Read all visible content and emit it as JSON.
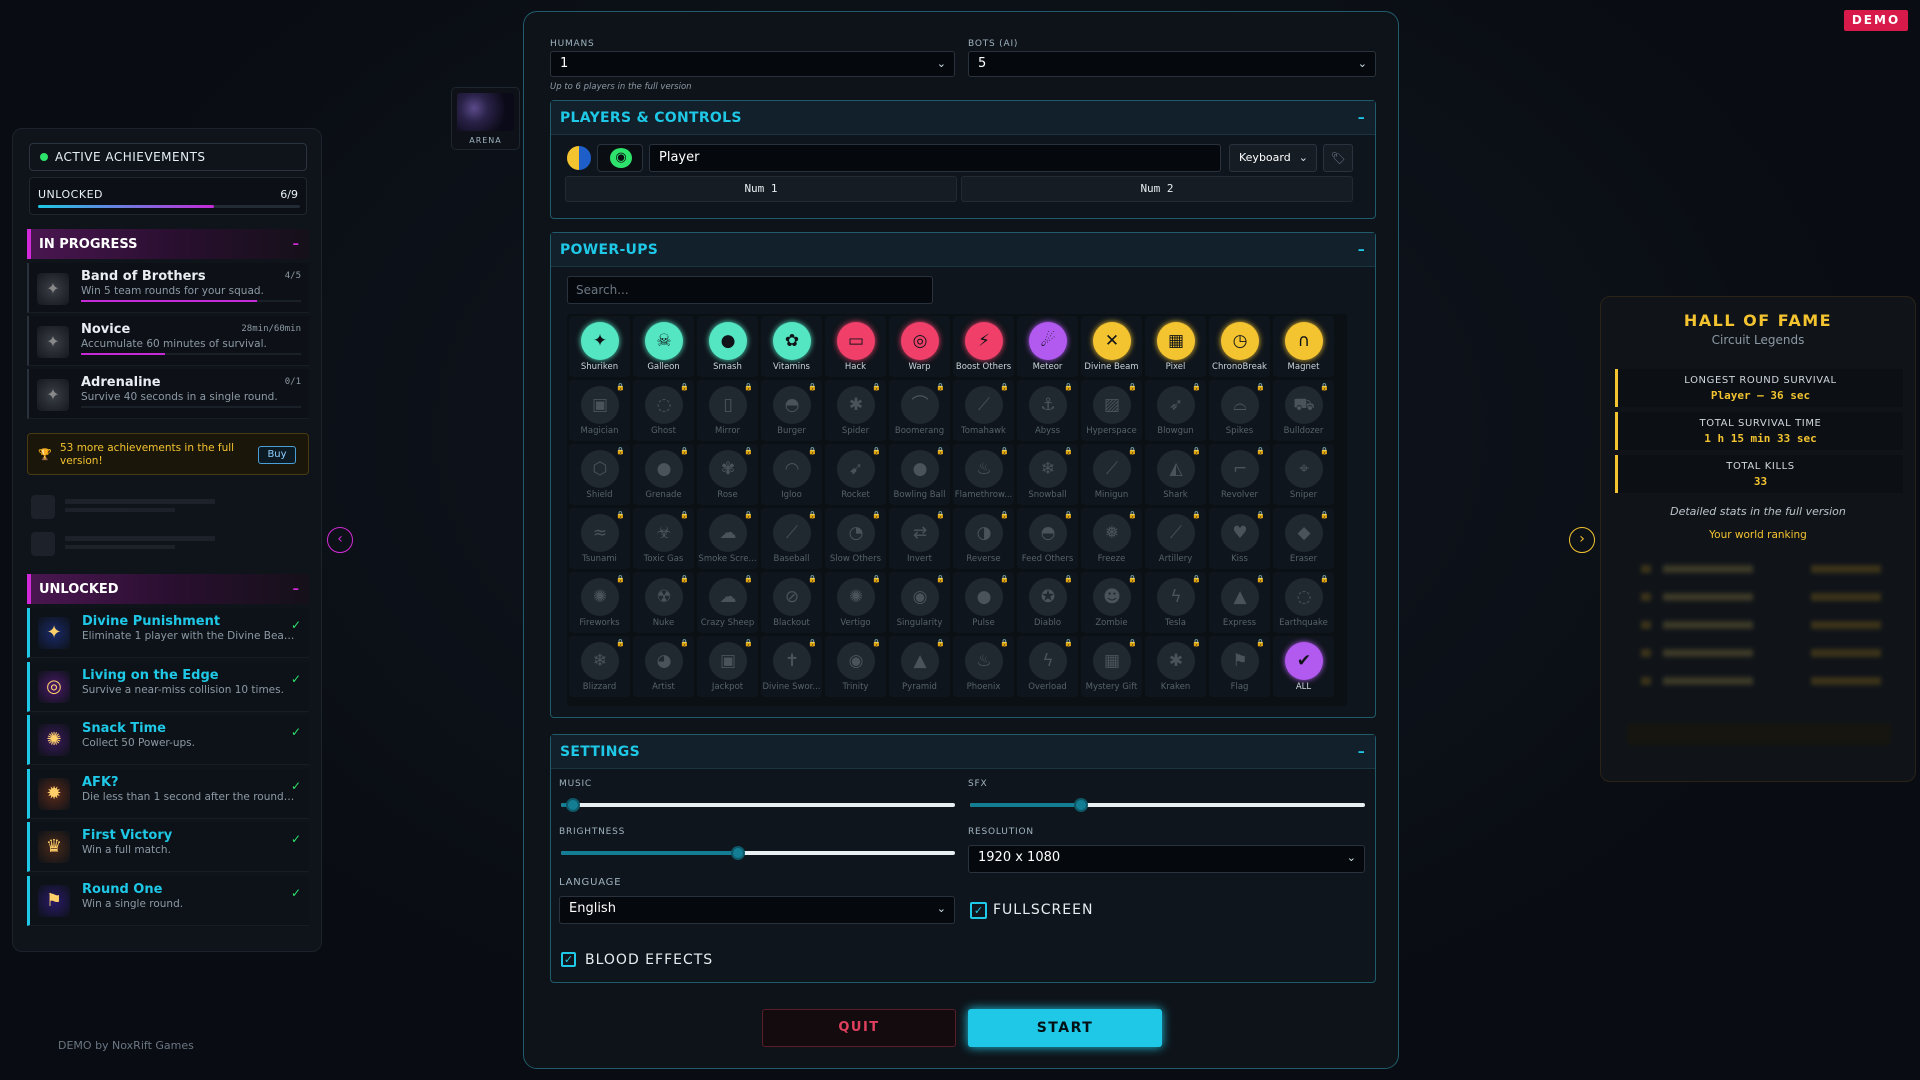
{
  "demo_badge": "DEMO",
  "credit": "DEMO by NoxRift Games",
  "left": {
    "header": "ACTIVE ACHIEVEMENTS",
    "unlocked_label": "UNLOCKED",
    "unlocked_count": "6/9",
    "unlocked_progress": 0.67,
    "in_progress_title": "IN PROGRESS",
    "in_progress": [
      {
        "title": "Band of Brothers",
        "desc": "Win 5 team rounds for your squad.",
        "count": "4/5",
        "progress": 0.8,
        "icon": "helmet-icon"
      },
      {
        "title": "Novice",
        "desc": "Accumulate 60 minutes of survival.",
        "count": "28min/60min",
        "progress": 0.38,
        "icon": "stopwatch-icon"
      },
      {
        "title": "Adrenaline",
        "desc": "Survive 40 seconds in a single round.",
        "count": "0/1",
        "progress": 0,
        "icon": "lightning-icon"
      }
    ],
    "buy_text": "53 more achievements in the full version!",
    "buy_button": "Buy",
    "unlocked_title": "UNLOCKED",
    "unlocked": [
      {
        "title": "Divine Punishment",
        "desc": "Eliminate 1 player with the Divine Beam.",
        "icon": "beam-icon",
        "bg": "#1a2a6a"
      },
      {
        "title": "Living on the Edge",
        "desc": "Survive a near-miss collision 10 times.",
        "icon": "swirl-icon",
        "bg": "#4a1a6a"
      },
      {
        "title": "Snack Time",
        "desc": "Collect 50 Power-ups.",
        "icon": "snack-icon",
        "bg": "#3a1a5a"
      },
      {
        "title": "AFK?",
        "desc": "Die less than 1 second after the round starts.",
        "icon": "explosion-icon",
        "bg": "#5a2a1a"
      },
      {
        "title": "First Victory",
        "desc": "Win a full match.",
        "icon": "trophy-icon",
        "bg": "#4a2a1a"
      },
      {
        "title": "Round One",
        "desc": "Win a single round.",
        "icon": "flag-icon",
        "bg": "#2a1a6a"
      }
    ]
  },
  "arena_label": "ARENA",
  "main": {
    "humans_label": "HUMANS",
    "humans_value": "1",
    "bots_label": "BOTS (AI)",
    "bots_value": "5",
    "hint": "Up to 6 players in the full version",
    "players_title": "PLAYERS & CONTROLS",
    "player_name": "Player",
    "control": "Keyboard",
    "key_left": "Num 1",
    "key_right": "Num 2",
    "powerups_title": "POWER-UPS",
    "search_placeholder": "Search...",
    "powerups": [
      {
        "name": "Shuriken",
        "icon": "✦",
        "color": "#54e6c2",
        "locked": false
      },
      {
        "name": "Galleon",
        "icon": "☠",
        "color": "#54e6c2",
        "locked": false
      },
      {
        "name": "Smash",
        "icon": "●",
        "color": "#54e6c2",
        "locked": false
      },
      {
        "name": "Vitamins",
        "icon": "✿",
        "color": "#54e6c2",
        "locked": false
      },
      {
        "name": "Hack",
        "icon": "▭",
        "color": "#f0406a",
        "locked": false
      },
      {
        "name": "Warp",
        "icon": "◎",
        "color": "#f0406a",
        "locked": false
      },
      {
        "name": "Boost Others",
        "icon": "⚡",
        "color": "#f0406a",
        "locked": false
      },
      {
        "name": "Meteor",
        "icon": "☄",
        "color": "#b25af0",
        "locked": false
      },
      {
        "name": "Divine Beam",
        "icon": "✕",
        "color": "#f3c330",
        "locked": false
      },
      {
        "name": "Pixel",
        "icon": "▦",
        "color": "#f3c330",
        "locked": false
      },
      {
        "name": "ChronoBreak",
        "icon": "◷",
        "color": "#f3c330",
        "locked": false
      },
      {
        "name": "Magnet",
        "icon": "∩",
        "color": "#f3c330",
        "locked": false
      },
      {
        "name": "Magician",
        "icon": "▣",
        "locked": true
      },
      {
        "name": "Ghost",
        "icon": "◌",
        "locked": true
      },
      {
        "name": "Mirror",
        "icon": "▯",
        "locked": true
      },
      {
        "name": "Burger",
        "icon": "◓",
        "locked": true
      },
      {
        "name": "Spider",
        "icon": "✱",
        "locked": true
      },
      {
        "name": "Boomerang",
        "icon": "⌒",
        "locked": true
      },
      {
        "name": "Tomahawk",
        "icon": "⟋",
        "locked": true
      },
      {
        "name": "Abyss",
        "icon": "⚓",
        "locked": true
      },
      {
        "name": "Hyperspace",
        "icon": "▨",
        "locked": true
      },
      {
        "name": "Blowgun",
        "icon": "➶",
        "locked": true
      },
      {
        "name": "Spikes",
        "icon": "⌓",
        "locked": true
      },
      {
        "name": "Bulldozer",
        "icon": "⛟",
        "locked": true
      },
      {
        "name": "Shield",
        "icon": "⬡",
        "locked": true
      },
      {
        "name": "Grenade",
        "icon": "●",
        "locked": true
      },
      {
        "name": "Rose",
        "icon": "✾",
        "locked": true
      },
      {
        "name": "Igloo",
        "icon": "◠",
        "locked": true
      },
      {
        "name": "Rocket",
        "icon": "➹",
        "locked": true
      },
      {
        "name": "Bowling Ball",
        "icon": "●",
        "locked": true
      },
      {
        "name": "Flamethrow...",
        "icon": "♨",
        "locked": true
      },
      {
        "name": "Snowball",
        "icon": "❄",
        "locked": true
      },
      {
        "name": "Minigun",
        "icon": "⟋",
        "locked": true
      },
      {
        "name": "Shark",
        "icon": "◭",
        "locked": true
      },
      {
        "name": "Revolver",
        "icon": "⌐",
        "locked": true
      },
      {
        "name": "Sniper",
        "icon": "⌖",
        "locked": true
      },
      {
        "name": "Tsunami",
        "icon": "≈",
        "locked": true
      },
      {
        "name": "Toxic Gas",
        "icon": "☣",
        "locked": true
      },
      {
        "name": "Smoke Scre...",
        "icon": "☁",
        "locked": true
      },
      {
        "name": "Baseball",
        "icon": "⟋",
        "locked": true
      },
      {
        "name": "Slow Others",
        "icon": "◔",
        "locked": true
      },
      {
        "name": "Invert",
        "icon": "⇄",
        "locked": true
      },
      {
        "name": "Reverse",
        "icon": "◑",
        "locked": true
      },
      {
        "name": "Feed Others",
        "icon": "◓",
        "locked": true
      },
      {
        "name": "Freeze",
        "icon": "❅",
        "locked": true
      },
      {
        "name": "Artillery",
        "icon": "⟋",
        "locked": true
      },
      {
        "name": "Kiss",
        "icon": "♥",
        "locked": true
      },
      {
        "name": "Eraser",
        "icon": "◆",
        "locked": true
      },
      {
        "name": "Fireworks",
        "icon": "✺",
        "locked": true
      },
      {
        "name": "Nuke",
        "icon": "☢",
        "locked": true
      },
      {
        "name": "Crazy Sheep",
        "icon": "☁",
        "locked": true
      },
      {
        "name": "Blackout",
        "icon": "⊘",
        "locked": true
      },
      {
        "name": "Vertigo",
        "icon": "✺",
        "locked": true
      },
      {
        "name": "Singularity",
        "icon": "◉",
        "locked": true
      },
      {
        "name": "Pulse",
        "icon": "●",
        "locked": true
      },
      {
        "name": "Diablo",
        "icon": "✪",
        "locked": true
      },
      {
        "name": "Zombie",
        "icon": "☻",
        "locked": true
      },
      {
        "name": "Tesla",
        "icon": "ϟ",
        "locked": true
      },
      {
        "name": "Express",
        "icon": "▲",
        "locked": true
      },
      {
        "name": "Earthquake",
        "icon": "◌",
        "locked": true
      },
      {
        "name": "Blizzard",
        "icon": "❄",
        "locked": true
      },
      {
        "name": "Artist",
        "icon": "◕",
        "locked": true
      },
      {
        "name": "Jackpot",
        "icon": "▣",
        "locked": true
      },
      {
        "name": "Divine Swor...",
        "icon": "✝",
        "locked": true
      },
      {
        "name": "Trinity",
        "icon": "◉",
        "locked": true
      },
      {
        "name": "Pyramid",
        "icon": "▲",
        "locked": true
      },
      {
        "name": "Phoenix",
        "icon": "♨",
        "locked": true
      },
      {
        "name": "Overload",
        "icon": "ϟ",
        "locked": true
      },
      {
        "name": "Mystery Gift",
        "icon": "▦",
        "locked": true
      },
      {
        "name": "Kraken",
        "icon": "✱",
        "locked": true
      },
      {
        "name": "Flag",
        "icon": "⚑",
        "locked": true
      },
      {
        "name": "ALL",
        "icon": "✔",
        "color": "#b25af0",
        "locked": false
      }
    ],
    "settings_title": "SETTINGS",
    "music_label": "MUSIC",
    "music_level": 0.03,
    "sfx_label": "SFX",
    "sfx_level": 0.28,
    "brightness_label": "BRIGHTNESS",
    "brightness_level": 0.45,
    "resolution_label": "RESOLUTION",
    "resolution_value": "1920 x 1080",
    "language_label": "LANGUAGE",
    "language_value": "English",
    "fullscreen_label": "FULLSCREEN",
    "blood_label": "BLOOD EFFECTS",
    "quit_label": "QUIT",
    "start_label": "START"
  },
  "right": {
    "title": "HALL OF FAME",
    "subtitle": "Circuit Legends",
    "stats": [
      {
        "label": "LONGEST ROUND SURVIVAL",
        "value": "Player — 36 sec"
      },
      {
        "label": "TOTAL SURVIVAL TIME",
        "value": "1 h 15 min 33 sec"
      },
      {
        "label": "TOTAL KILLS",
        "value": "33"
      }
    ],
    "note": "Detailed stats in the full version",
    "ranking_label": "Your world ranking"
  },
  "colors": {
    "accent": "#1ec8e6",
    "magenta": "#d22ad8",
    "gold": "#f3c330",
    "danger": "#d81a4a"
  }
}
